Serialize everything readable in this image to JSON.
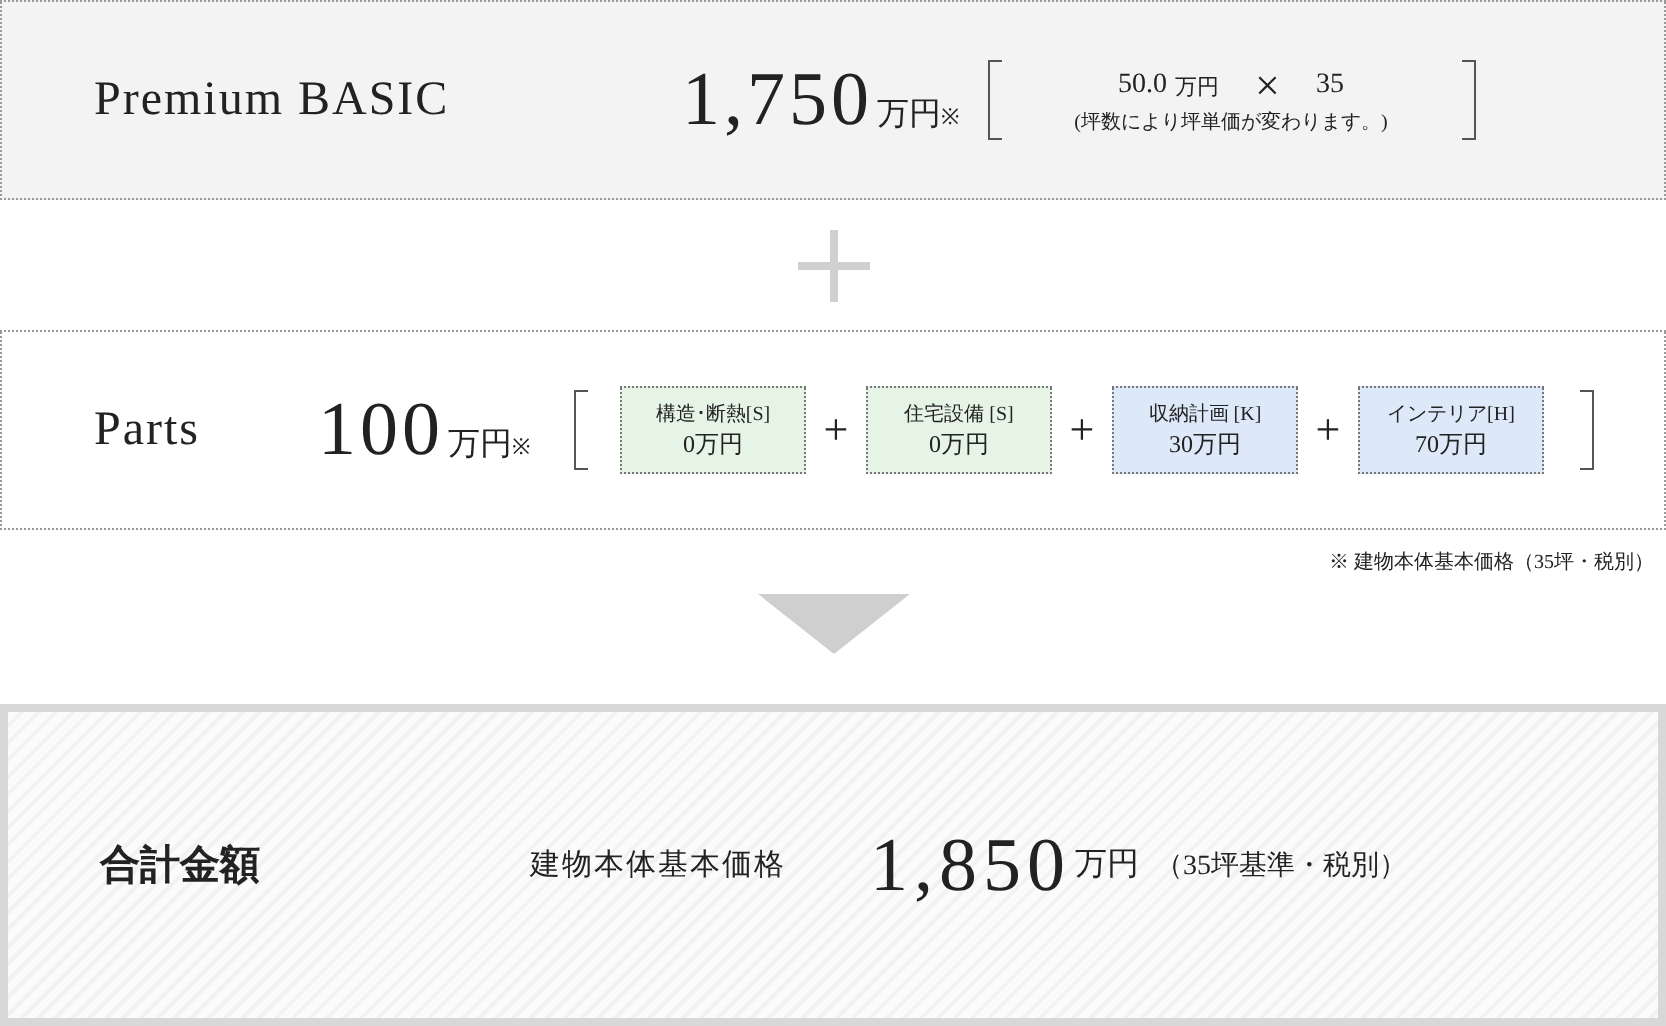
{
  "basic": {
    "name": "Premium BASIC",
    "price": "1,750",
    "unit": "万円",
    "mark": "※",
    "formula": {
      "unit_price": "50.0",
      "unit": "万円",
      "times": "×",
      "count": "35",
      "note": "(坪数により坪単価が変わります。)"
    }
  },
  "parts": {
    "name": "Parts",
    "price": "100",
    "unit": "万円",
    "mark": "※",
    "items": [
      {
        "label": "構造･断熱[S]",
        "price": "0万円",
        "color": "#e6f4e6"
      },
      {
        "label": "住宅設備 [S]",
        "price": "0万円",
        "color": "#e6f4e6"
      },
      {
        "label": "収納計画 [K]",
        "price": "30万円",
        "color": "#dde9f9"
      },
      {
        "label": "インテリア[H]",
        "price": "70万円",
        "color": "#dde9f9"
      }
    ],
    "operators": [
      "+",
      "+",
      "+"
    ]
  },
  "note": "※ 建物本体基本価格（35坪・税別）",
  "total": {
    "title": "合計金額",
    "label": "建物本体基本価格",
    "price": "1,850",
    "unit": "万円",
    "detail": "（35坪基準・税別）"
  }
}
